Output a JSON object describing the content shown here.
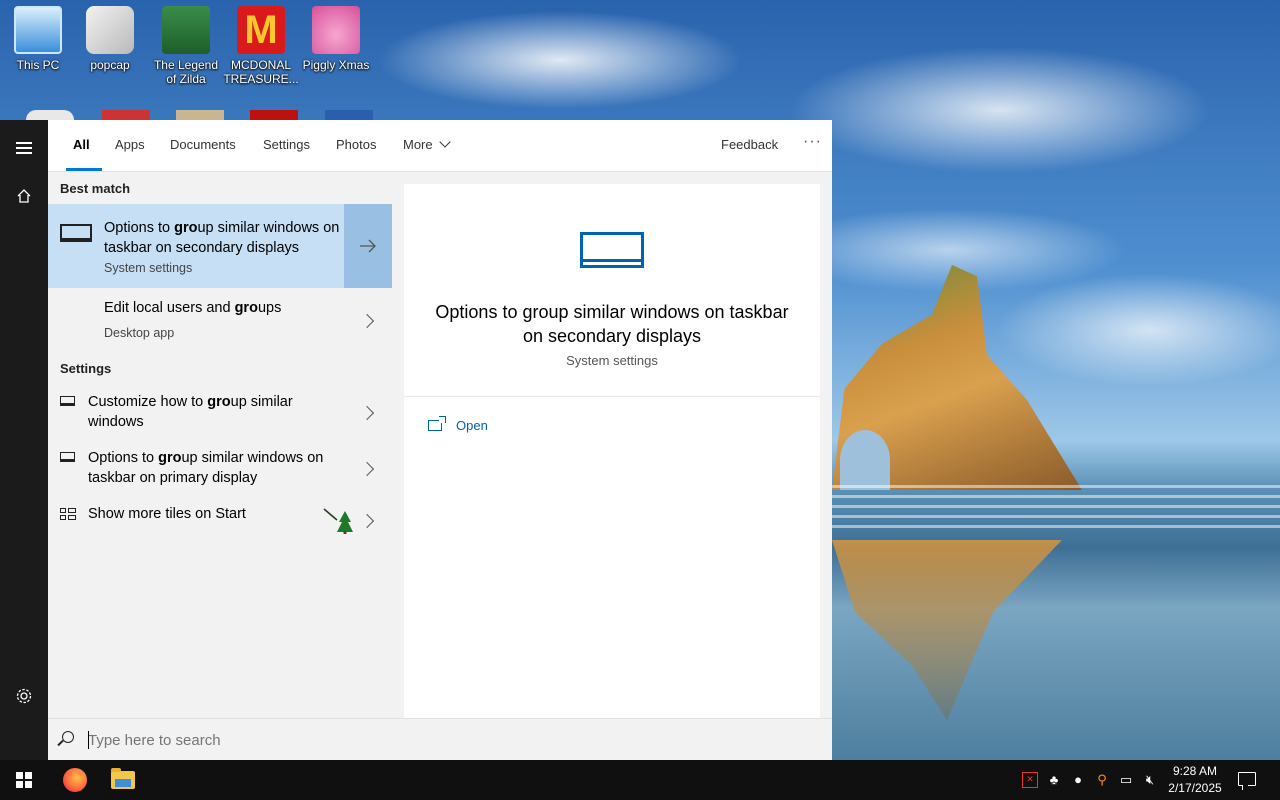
{
  "desktop": {
    "icons": [
      {
        "label": "This PC",
        "icon": "computer-icon"
      },
      {
        "label": "popcap",
        "icon": "popcap-icon"
      },
      {
        "label": "The Legend of Zilda",
        "icon": "zilda-game-icon"
      },
      {
        "label": "MCDONAL TREASURE...",
        "icon": "mcdonalds-icon"
      },
      {
        "label": "Piggly Xmas",
        "icon": "pig-icon"
      }
    ]
  },
  "rail": {
    "menu_icon": "hamburger-icon",
    "home_icon": "home-icon",
    "settings_icon": "gear-icon"
  },
  "tabs": {
    "items": [
      "All",
      "Apps",
      "Documents",
      "Settings",
      "Photos",
      "More"
    ],
    "active": "All",
    "feedback": "Feedback",
    "overflow": "···"
  },
  "results": {
    "best_match_heading": "Best match",
    "best_match": {
      "title_pre": "Options to ",
      "title_bold": "gro",
      "title_post": "up similar windows on taskbar on secondary displays",
      "subtitle": "System settings"
    },
    "app_result": {
      "title_pre": "Edit local users and ",
      "title_bold": "gro",
      "title_post": "ups",
      "subtitle": "Desktop app"
    },
    "settings_heading": "Settings",
    "settings_items": [
      {
        "pre": "Customize how to ",
        "bold": "gro",
        "post": "up similar windows",
        "icon": "monitor-icon"
      },
      {
        "pre": "Options to ",
        "bold": "gro",
        "post": "up similar windows on taskbar on primary display",
        "icon": "monitor-icon"
      },
      {
        "pre": "Show more tiles on Start",
        "bold": "",
        "post": "",
        "icon": "tiles-icon"
      }
    ]
  },
  "preview": {
    "title": "Options to group similar windows on taskbar on secondary displays",
    "subtitle": "System settings",
    "open_label": "Open",
    "accent": "#0063b1"
  },
  "search": {
    "placeholder": "Type here to search",
    "value": ""
  },
  "taskbar": {
    "apps": [
      "start-icon",
      "firefox-icon",
      "file-explorer-icon"
    ],
    "time": "9:28 AM",
    "date": "2/17/2025"
  },
  "colors": {
    "highlight": "#c7dff5",
    "highlight_arrow": "#99c0e3",
    "accent": "#0078d7",
    "taskbar": "#101010"
  }
}
